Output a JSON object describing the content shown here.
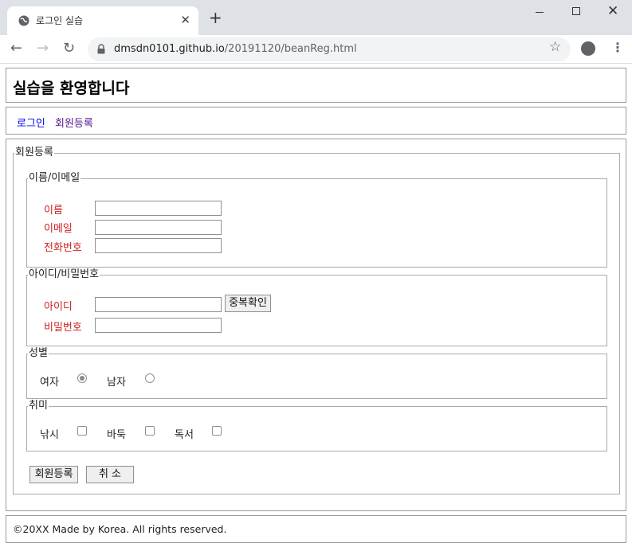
{
  "browser": {
    "tab_title": "로그인 실습",
    "url_host": "dmsdn0101.github.io",
    "url_path": "/20191120/beanReg.html"
  },
  "page": {
    "title": "실습을 환영합니다",
    "nav": [
      {
        "label": "로그인",
        "color": "#0000ee"
      },
      {
        "label": "회원등록",
        "color": "#551a8b"
      }
    ],
    "footer": "©20XX Made by Korea. All rights reserved."
  },
  "form": {
    "legend": "회원등록",
    "name_email": {
      "legend": "이름/이메일",
      "name_label": "이름",
      "email_label": "이메일",
      "phone_label": "전화번호"
    },
    "id_pw": {
      "legend": "아이디/비밀번호",
      "id_label": "아이디",
      "check_button": "중복확인",
      "pw_label": "비밀번호"
    },
    "gender": {
      "legend": "성별",
      "options": [
        {
          "label": "여자",
          "checked": true
        },
        {
          "label": "남자",
          "checked": false
        }
      ]
    },
    "hobby": {
      "legend": "취미",
      "options": [
        {
          "label": "낚시",
          "checked": false
        },
        {
          "label": "바둑",
          "checked": false
        },
        {
          "label": "독서",
          "checked": false
        }
      ]
    },
    "submit_button": "회원등록",
    "cancel_button": "취 소"
  },
  "colors": {
    "label_required": "#cc2222",
    "link": "#0000ee",
    "link_visited": "#551a8b"
  }
}
